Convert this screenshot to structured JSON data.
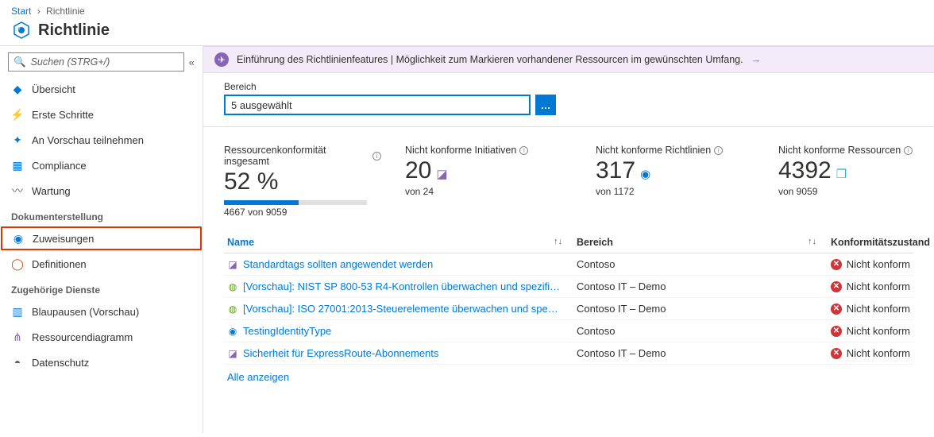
{
  "breadcrumb": {
    "start": "Start",
    "current": "Richtlinie"
  },
  "header": {
    "title": "Richtlinie"
  },
  "search": {
    "placeholder": "Suchen (STRG+/)"
  },
  "sidebar": {
    "items_top": [
      {
        "label": "Übersicht",
        "icon": "◆"
      },
      {
        "label": "Erste Schritte",
        "icon": "⚡"
      },
      {
        "label": "An Vorschau teilnehmen",
        "icon": "✦"
      },
      {
        "label": "Compliance",
        "icon": "▦"
      },
      {
        "label": "Wartung",
        "icon": "〰"
      }
    ],
    "section1": "Dokumenterstellung",
    "items_mid": [
      {
        "label": "Zuweisungen",
        "icon": "◉"
      },
      {
        "label": "Definitionen",
        "icon": "◯"
      }
    ],
    "section2": "Zugehörige Dienste",
    "items_bot": [
      {
        "label": "Blaupausen (Vorschau)",
        "icon": "▥"
      },
      {
        "label": "Ressourcendiagramm",
        "icon": "⋔"
      },
      {
        "label": "Datenschutz",
        "icon": "◓"
      }
    ]
  },
  "banner": {
    "text": "Einführung des Richtlinienfeatures | Möglichkeit zum Markieren vorhandener Ressourcen im gewünschten Umfang."
  },
  "scope": {
    "label": "Bereich",
    "value": "5 ausgewählt",
    "btn": "…"
  },
  "kpis": [
    {
      "title": "Ressourcenkonformität insgesamt",
      "big": "52 %",
      "sub": "4667 von 9059",
      "progress": true
    },
    {
      "title": "Nicht konforme Initiativen",
      "big": "20",
      "sub": "von 24",
      "icon": "◪",
      "icon_color": "#8764b8"
    },
    {
      "title": "Nicht konforme Richtlinien",
      "big": "317",
      "sub": "von 1172",
      "icon": "◉",
      "icon_color": "#0078d4"
    },
    {
      "title": "Nicht konforme Ressourcen",
      "big": "4392",
      "sub": "von 9059",
      "icon": "❒",
      "icon_color": "#32b1ca"
    }
  ],
  "table": {
    "headers": {
      "name": "Name",
      "scope": "Bereich",
      "status": "Konformitätszustand"
    },
    "rows": [
      {
        "icon": "◪",
        "icon_color": "#8764b8",
        "name": "Standardtags sollten angewendet werden",
        "scope": "Contoso",
        "status": "Nicht konform"
      },
      {
        "icon": "◍",
        "icon_color": "#57a300",
        "name": "[Vorschau]: NIST SP 800-53 R4-Kontrollen überwachen und spezifi…",
        "scope": "Contoso IT – Demo",
        "status": "Nicht konform"
      },
      {
        "icon": "◍",
        "icon_color": "#57a300",
        "name": "[Vorschau]: ISO 27001:2013-Steuerelemente überwachen und spe…",
        "scope": "Contoso IT – Demo",
        "status": "Nicht konform"
      },
      {
        "icon": "◉",
        "icon_color": "#0078d4",
        "name": "TestingIdentityType",
        "scope": "Contoso",
        "status": "Nicht konform"
      },
      {
        "icon": "◪",
        "icon_color": "#8764b8",
        "name": "Sicherheit für ExpressRoute-Abonnements",
        "scope": "Contoso IT – Demo",
        "status": "Nicht konform"
      }
    ],
    "show_all": "Alle anzeigen"
  }
}
